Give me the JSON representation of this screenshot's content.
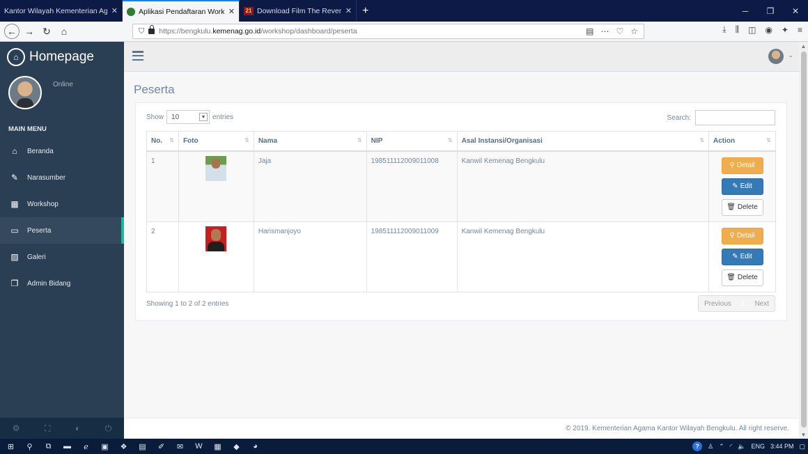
{
  "browser": {
    "tabs": [
      {
        "label": "Kantor Wilayah Kementerian Agam"
      },
      {
        "label": "Aplikasi Pendaftaran Worksho"
      },
      {
        "label": "Download Film The Revenant"
      }
    ],
    "new_tab": "+",
    "url_pre": "https://bengkulu.",
    "url_host": "kemenag.go.id",
    "url_post": "/workshop/dashboard/peserta",
    "url_actions": "⋯"
  },
  "sidebar": {
    "brand": "Homepage",
    "status": "Online",
    "menu_title": "MAIN MENU",
    "items": [
      {
        "label": "Beranda"
      },
      {
        "label": "Narasumber"
      },
      {
        "label": "Workshop"
      },
      {
        "label": "Peserta"
      },
      {
        "label": "Galeri"
      },
      {
        "label": "Admin Bidang"
      }
    ]
  },
  "page": {
    "title": "Peserta",
    "show_label": "Show",
    "entries_value": "10",
    "entries_label": "entries",
    "search_label": "Search:",
    "columns": [
      "No.",
      "Foto",
      "Nama",
      "NIP",
      "Asal Instansi/Organisasi",
      "Action"
    ],
    "rows": [
      {
        "no": "1",
        "nama": "Jaja",
        "nip": "198511112009011008",
        "asal": "Kanwil Kemenag Bengkulu"
      },
      {
        "no": "2",
        "nama": "Harismanjoyo",
        "nip": "198511112009011009",
        "asal": "Kanwil Kemenag Bengkulu"
      }
    ],
    "btn_detail": "Detail",
    "btn_edit": "Edit",
    "btn_delete": "Delete",
    "info": "Showing 1 to 2 of 2 entries",
    "pager_prev": "Previous",
    "pager_page": "1",
    "pager_next": "Next",
    "footer": "© 2019. Kementerian Agama Kantor Wilayah Bengkulu. All right reserve."
  },
  "taskbar": {
    "lang": "ENG",
    "time": "3:44 PM"
  },
  "colors": {
    "sidebar_bg": "#2a3f54",
    "detail_btn": "#f0ad4e",
    "edit_btn": "#337ab7",
    "active_accent": "#1abb9c"
  }
}
